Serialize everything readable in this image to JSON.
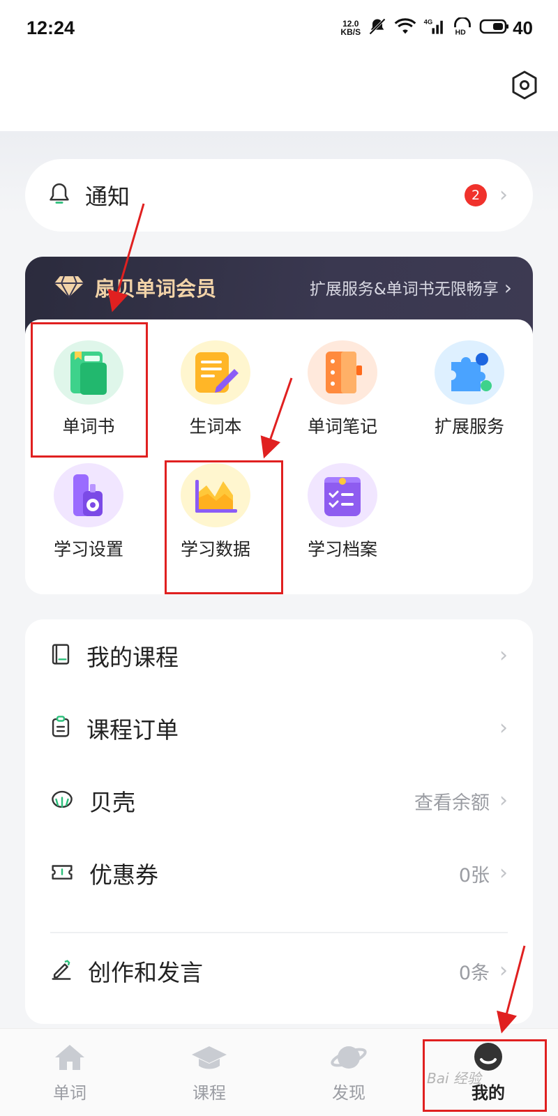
{
  "status_bar": {
    "time": "12:24",
    "net_speed_value": "12.0",
    "net_speed_unit": "KB/S",
    "battery": "40"
  },
  "notification": {
    "label": "通知",
    "badge_count": "2"
  },
  "vip": {
    "title": "扇贝单词会员",
    "subtitle": "扩展服务&单词书无限畅享",
    "items": [
      {
        "label": "单词书",
        "icon": "green-book-icon"
      },
      {
        "label": "生词本",
        "icon": "notepad-pencil-icon"
      },
      {
        "label": "单词笔记",
        "icon": "orange-notebook-icon"
      },
      {
        "label": "扩展服务",
        "icon": "puzzle-icon"
      },
      {
        "label": "学习设置",
        "icon": "settings-bottle-icon"
      },
      {
        "label": "学习数据",
        "icon": "area-chart-icon"
      },
      {
        "label": "学习档案",
        "icon": "checklist-folder-icon"
      }
    ]
  },
  "menu": [
    {
      "label": "我的课程",
      "value": "",
      "icon": "course-book-icon"
    },
    {
      "label": "课程订单",
      "value": "",
      "icon": "clipboard-icon"
    },
    {
      "label": "贝壳",
      "value": "查看余额",
      "icon": "shell-icon"
    },
    {
      "label": "优惠券",
      "value": "0张",
      "icon": "ticket-icon"
    },
    {
      "label": "创作和发言",
      "value": "0条",
      "icon": "edit-pen-icon"
    }
  ],
  "bottom_nav": [
    {
      "label": "单词",
      "icon": "home-icon"
    },
    {
      "label": "课程",
      "icon": "graduation-cap-icon"
    },
    {
      "label": "发现",
      "icon": "planet-icon"
    },
    {
      "label": "我的",
      "icon": "profile-icon",
      "active": true
    }
  ],
  "watermark": "Bai 经验",
  "colors": {
    "accent_red": "#f0322c",
    "vip_gold": "#f2d3a8",
    "vip_dark": "#2b2b3d",
    "highlight": "#e02020"
  }
}
